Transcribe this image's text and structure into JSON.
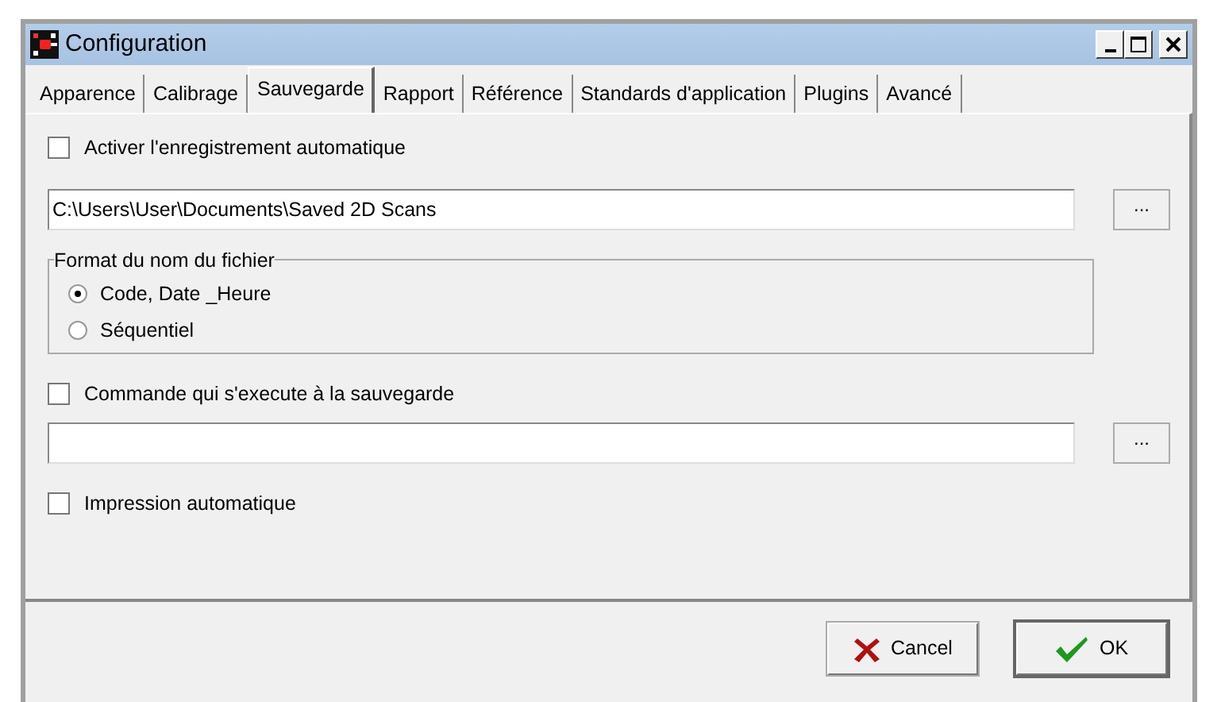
{
  "window": {
    "title": "Configuration"
  },
  "tabs": [
    {
      "label": "Apparence",
      "selected": false
    },
    {
      "label": "Calibrage",
      "selected": false
    },
    {
      "label": "Sauvegarde",
      "selected": true
    },
    {
      "label": "Rapport",
      "selected": false
    },
    {
      "label": "Référence",
      "selected": false
    },
    {
      "label": "Standards d'application",
      "selected": false
    },
    {
      "label": "Plugins",
      "selected": false
    },
    {
      "label": "Avancé",
      "selected": false
    }
  ],
  "auto_save": {
    "label": "Activer l'enregistrement automatique",
    "checked": false
  },
  "save_path": {
    "value": "C:\\Users\\User\\Documents\\Saved 2D Scans",
    "browse": "..."
  },
  "filename_format": {
    "title": "Format du nom du fichier",
    "options": [
      {
        "label": "Code, Date _Heure",
        "selected": true
      },
      {
        "label": "Séquentiel",
        "selected": false
      }
    ]
  },
  "save_command": {
    "label": "Commande qui s'execute à la sauvegarde",
    "checked": false,
    "browse": "..."
  },
  "auto_print": {
    "label": "Impression automatique",
    "checked": false
  },
  "buttons": [
    {
      "kind": "cancel",
      "label": "Cancel"
    },
    {
      "kind": "ok",
      "label": "OK"
    }
  ]
}
